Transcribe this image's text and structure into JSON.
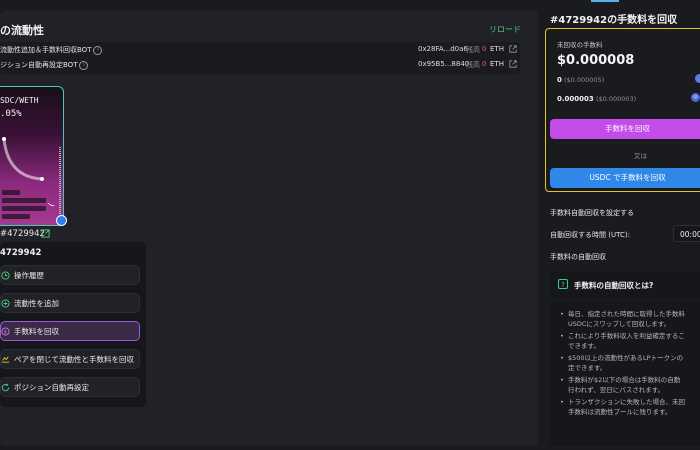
{
  "left_panel": {
    "title": "の流動性",
    "reload_label": "リロード",
    "bots": [
      {
        "name": "流動性追加＆手数料回収BOT",
        "address": "0x28FA...d0a6",
        "balance_label": "残高",
        "balance_value": "0",
        "unit": "ETH"
      },
      {
        "name": "ジション自動再設定BOT",
        "address": "0x95B5...8840",
        "balance_label": "残高",
        "balance_value": "0",
        "unit": "ETH"
      }
    ]
  },
  "nft": {
    "pair": "SDC/WETH",
    "fee": ".05%",
    "token_id": "#4729942"
  },
  "menu": {
    "title": "4729942",
    "items": [
      {
        "label": "操作履歴",
        "icon": "history-icon"
      },
      {
        "label": "流動性を追加",
        "icon": "add-liquidity-icon"
      },
      {
        "label": "手数料を回収",
        "icon": "collect-fee-icon"
      },
      {
        "label": "ペアを閉じて流動性と手数料を回収",
        "icon": "close-pair-icon"
      },
      {
        "label": "ポジション自動再設定",
        "icon": "auto-reset-icon"
      }
    ],
    "active_index": 2
  },
  "fee_panel": {
    "title": "#4729942の手数料を回収",
    "uncollected_label": "未回収の手数料",
    "uncollected_value": "$0.000008",
    "rows": [
      {
        "amount": "0",
        "usd": "($0.000005)"
      },
      {
        "amount": "0.000003",
        "usd": "($0.000003)"
      }
    ],
    "collect_button": "手数料を回収",
    "or_text": "又は",
    "usdc_button": "USDC で手数料を回収"
  },
  "auto_collect": {
    "section_title": "手数料自動回収を設定する",
    "time_label": "自動回収する時間 (UTC):",
    "time_value": "00:00",
    "heading": "手数料の自動回収",
    "faq_title": "手数料の自動回収とは?",
    "faq_lines": [
      "毎日、指定された時間に取得した手数料",
      "USDCにスワップして回収します。",
      "これにより手数料収入を利益確定するこ",
      "できます。",
      "$500以上の流動性があるLPトークンの",
      "定できます。",
      "手数料が$2以下の場合は手数料の自動",
      "行われず、翌日にパスされます。",
      "トランザクションに失敗した場合、未回",
      "手数料は流動性プールに残ります。"
    ]
  },
  "colors": {
    "accent_purple": "#c14ce8",
    "accent_blue": "#2f88e8",
    "accent_yellow": "#e5c227",
    "accent_green": "#4fd080",
    "balance_red": "#e45a5a"
  }
}
